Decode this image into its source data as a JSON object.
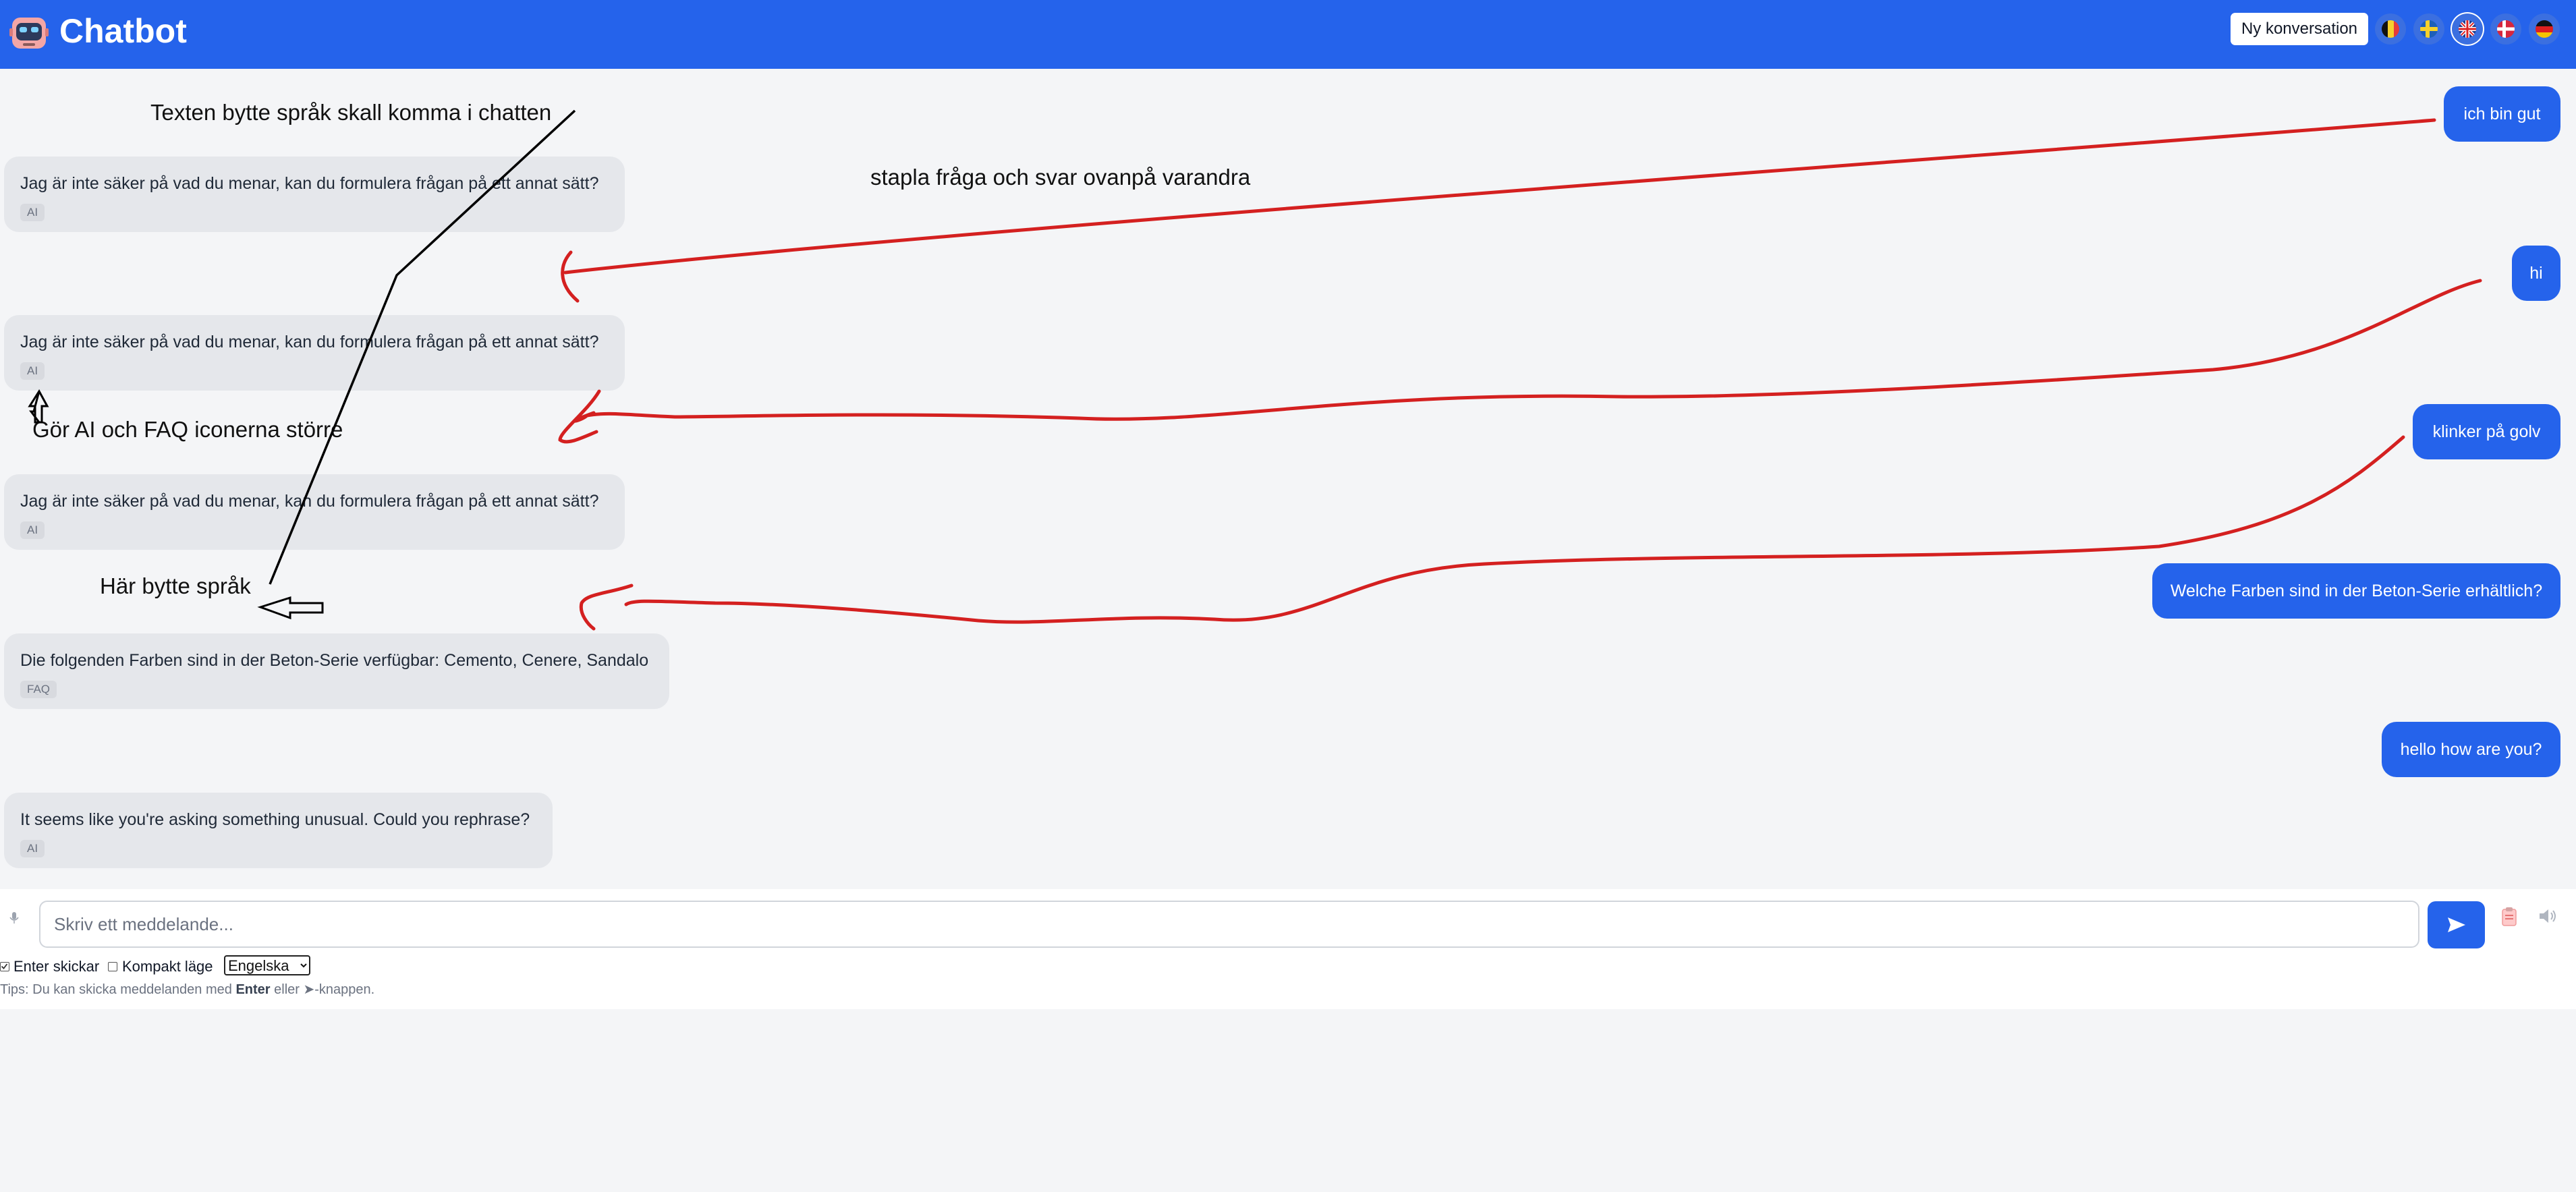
{
  "header": {
    "title": "Chatbot",
    "new_conversation": "Ny konversation",
    "languages": [
      "belgian-flag-icon",
      "swedish-flag-icon",
      "english-flag-icon",
      "danish-flag-icon",
      "german-flag-icon"
    ],
    "accent": "#2563eb"
  },
  "messages": {
    "user": [
      {
        "text": "ich bin gut"
      },
      {
        "text": "hi"
      },
      {
        "text": "klinker på golv"
      },
      {
        "text": "Welche Farben sind in der Beton-Serie erhältlich?"
      },
      {
        "text": "hello how are you?"
      }
    ],
    "bot": [
      {
        "text": "Jag är inte säker på vad du menar, kan du formulera frågan på ett annat sätt?",
        "source": "AI"
      },
      {
        "text": "Jag är inte säker på vad du menar, kan du formulera frågan på ett annat sätt?",
        "source": "AI"
      },
      {
        "text": "Jag är inte säker på vad du menar, kan du formulera frågan på ett annat sätt?",
        "source": "AI"
      },
      {
        "text": "Die folgenden Farben sind in der Beton-Serie verfügbar: Cemento, Cenere, Sandalo",
        "source": "FAQ"
      },
      {
        "text": "It seems like you're asking something unusual. Could you rephrase?",
        "source": "AI"
      }
    ]
  },
  "input": {
    "placeholder": "Skriv ett meddelande...",
    "value": ""
  },
  "options": {
    "enter_sends": "Enter skickar",
    "enter_sends_checked": true,
    "compact_mode": "Kompakt läge",
    "compact_mode_checked": false,
    "language_selected": "Engelska",
    "tip_prefix": "Tips: Du kan skicka meddelanden med",
    "tip_key": "Enter",
    "tip_middle": "eller",
    "tip_suffix": "-knappen."
  },
  "annotations": {
    "note_language_text": "Texten bytte språk skall komma i chatten",
    "note_stack": "stapla fråga och svar ovanpå varandra",
    "note_icons": "Gör AI och FAQ iconerna större",
    "note_switched": "Här bytte språk"
  }
}
